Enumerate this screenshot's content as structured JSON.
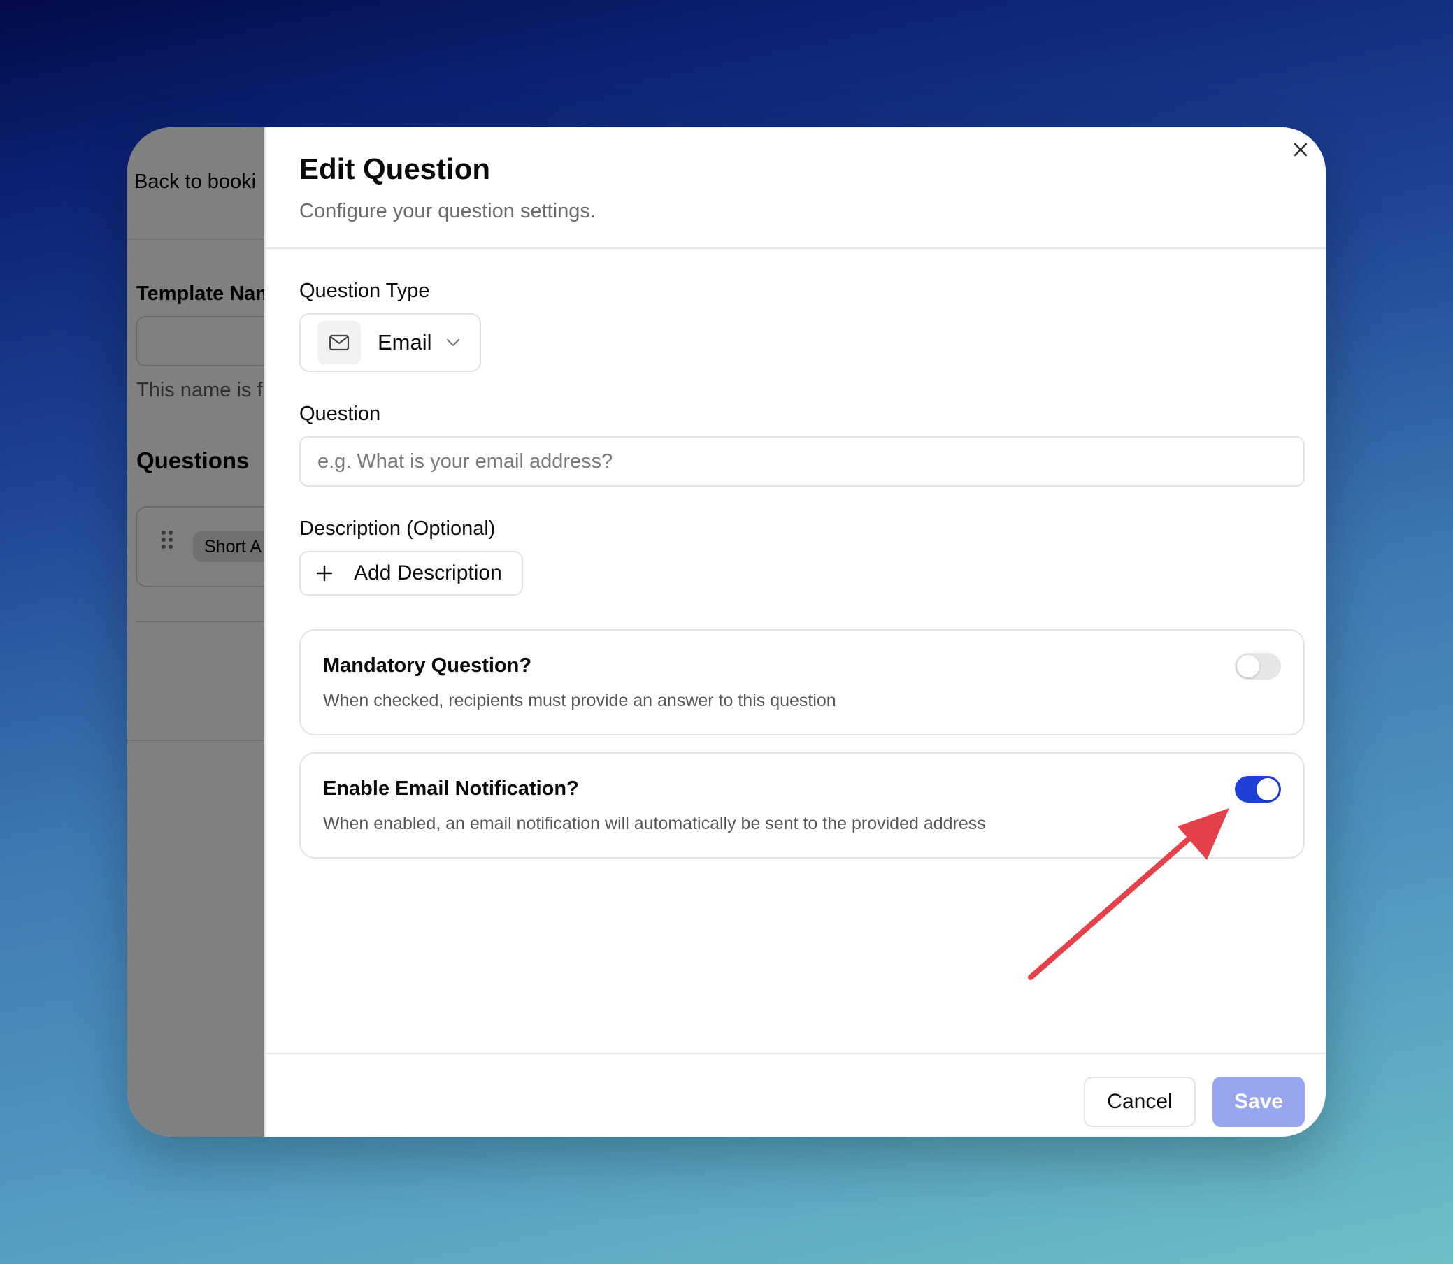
{
  "background_page": {
    "back_link": "Back to booki",
    "template_name_label": "Template Nam",
    "template_name_note": "This name is f",
    "questions_heading": "Questions",
    "question_chip": "Short A"
  },
  "dialog": {
    "title": "Edit Question",
    "subtitle": "Configure your question settings.",
    "question_type": {
      "label": "Question Type",
      "selected": "Email",
      "icon": "mail-icon"
    },
    "question": {
      "label": "Question",
      "value": "",
      "placeholder": "e.g. What is your email address?"
    },
    "description": {
      "label": "Description (Optional)",
      "add_button": "Add Description"
    },
    "settings": [
      {
        "title": "Mandatory Question?",
        "description": "When checked, recipients must provide an answer to this question",
        "enabled": false
      },
      {
        "title": "Enable Email Notification?",
        "description": "When enabled, an email notification will automatically be sent to the provided address",
        "enabled": true
      }
    ],
    "footer": {
      "cancel": "Cancel",
      "save": "Save"
    }
  },
  "colors": {
    "accent": "#1f3fd6",
    "save_disabled": "#97a6ef",
    "annotation_arrow": "#e5414b"
  }
}
